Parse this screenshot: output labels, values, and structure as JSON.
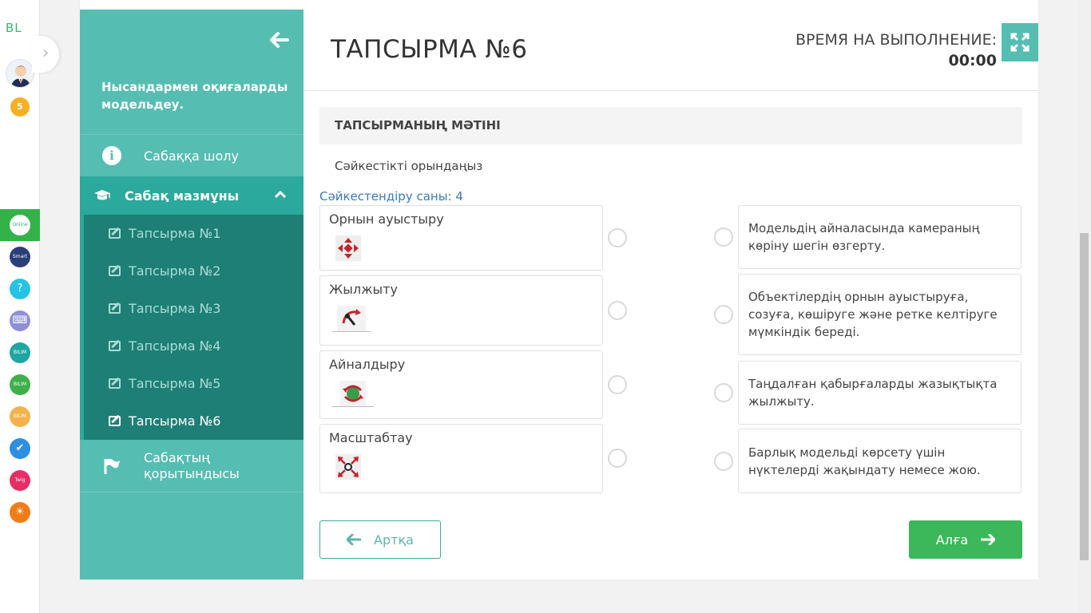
{
  "rail": {
    "logo": "BL",
    "badge_count": "5",
    "apps": [
      {
        "name": "online-mektep",
        "text": "Online Mektep",
        "color": "#2fae73",
        "active": true
      },
      {
        "name": "smart-nation",
        "text": "Smart Nation",
        "color": "#2a3f7a",
        "active": false
      },
      {
        "name": "help",
        "text": "?",
        "color": "#27c3e6",
        "active": false
      },
      {
        "name": "keyboard",
        "text": "⌨",
        "color": "#8e8fd6",
        "active": false
      },
      {
        "name": "bilim-central",
        "text": "BILIM Central",
        "color": "#1fa5a2",
        "active": false
      },
      {
        "name": "bilim-land",
        "text": "BILIM Land",
        "color": "#3db04a",
        "active": false
      },
      {
        "name": "bilim-store",
        "text": "BILIM Store",
        "color": "#f3b24e",
        "active": false
      },
      {
        "name": "check-app",
        "text": "✔",
        "color": "#2d8fe0",
        "active": false
      },
      {
        "name": "twig",
        "text": "Twig",
        "color": "#e72e64",
        "active": false
      },
      {
        "name": "imagineering",
        "text": "☀",
        "color": "#ef7d16",
        "active": false
      }
    ]
  },
  "sidebar": {
    "lesson_title": "Нысандармен оқиғаларды модельдеу.",
    "overview_label": "Сабаққа шолу",
    "content_label": "Сабақ мазмұны",
    "tasks": [
      {
        "label": "Тапсырма №1",
        "active": false
      },
      {
        "label": "Тапсырма №2",
        "active": false
      },
      {
        "label": "Тапсырма №3",
        "active": false
      },
      {
        "label": "Тапсырма №4",
        "active": false
      },
      {
        "label": "Тапсырма №5",
        "active": false
      },
      {
        "label": "Тапсырма №6",
        "active": true
      }
    ],
    "conclusion_label": "Сабақтың қорытындысы"
  },
  "header": {
    "title": "ТАПСЫРМА №6",
    "timer_label": "ВРЕМЯ НА ВЫПОЛНЕНИЕ:",
    "timer_value": "00:00"
  },
  "task": {
    "text_heading": "ТАПСЫРМАНЫҢ МӘТІНІ",
    "instruction": "Сәйкестікті орындаңыз",
    "match_count": "Сәйкестендіру саны: 4",
    "left_items": [
      {
        "label": "Орнын ауыстыру",
        "icon": "move-icon"
      },
      {
        "label": "Жылжыту",
        "icon": "push-icon"
      },
      {
        "label": "Айналдыру",
        "icon": "rotate-icon"
      },
      {
        "label": "Масштабтау",
        "icon": "scale-icon"
      }
    ],
    "right_items": [
      "Модельдің айналасында камераның көріну шегін өзгерту.",
      "Объектілердің орнын ауыстыруға, созуға, көшіруге және ретке келтіруге мүмкіндік береді.",
      "Таңдалған қабырғаларды жазықтықта жылжыту.",
      "Барлық модельді көрсету үшін нүктелерді жақындату немесе жою."
    ]
  },
  "buttons": {
    "back_label": "Артқа",
    "next_label": "Алға"
  },
  "colors": {
    "sidebar": "#56bdb2",
    "sidebar_section": "#2ba99c",
    "sidebar_sublist": "#1e7f76",
    "next_button": "#3cb75a",
    "link": "#3a7bb5"
  }
}
